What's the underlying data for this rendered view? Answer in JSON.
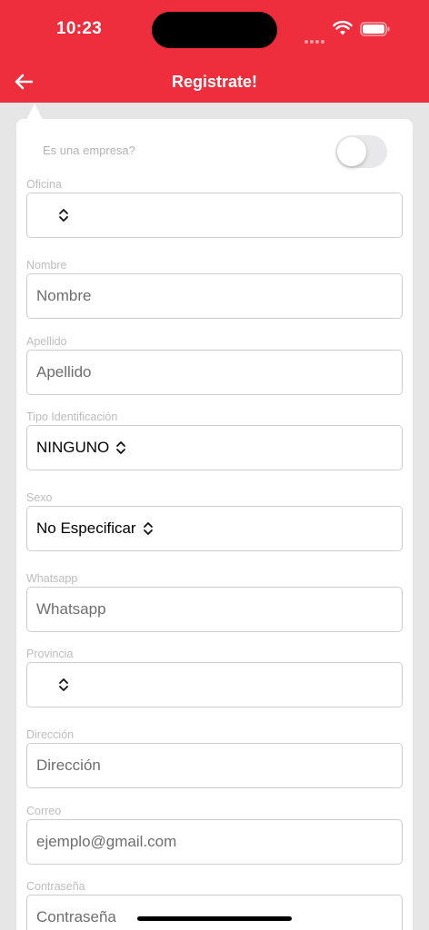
{
  "status_bar": {
    "time": "10:23"
  },
  "header": {
    "title": "Registrate!",
    "back_icon": "arrow-left-icon"
  },
  "colors": {
    "accent": "#ee2d3d",
    "background": "#e6e6e6",
    "card": "#ffffff"
  },
  "form": {
    "company_toggle": {
      "label": "Es una empresa?",
      "on": false
    },
    "oficina": {
      "label": "Oficina",
      "value": ""
    },
    "nombre": {
      "label": "Nombre",
      "placeholder": "Nombre"
    },
    "apellido": {
      "label": "Apellido",
      "placeholder": "Apellido"
    },
    "tipo_identificacion": {
      "label": "Tipo Identificación",
      "value": "NINGUNO"
    },
    "sexo": {
      "label": "Sexo",
      "value": "No Especificar"
    },
    "whatsapp": {
      "label": "Whatsapp",
      "placeholder": "Whatsapp"
    },
    "provincia": {
      "label": "Provincia",
      "value": ""
    },
    "direccion": {
      "label": "Dirección",
      "placeholder": "Dirección"
    },
    "correo": {
      "label": "Correo",
      "placeholder": "ejemplo@gmail.com"
    },
    "contrasena": {
      "label": "Contraseña",
      "placeholder": "Contraseña"
    }
  }
}
